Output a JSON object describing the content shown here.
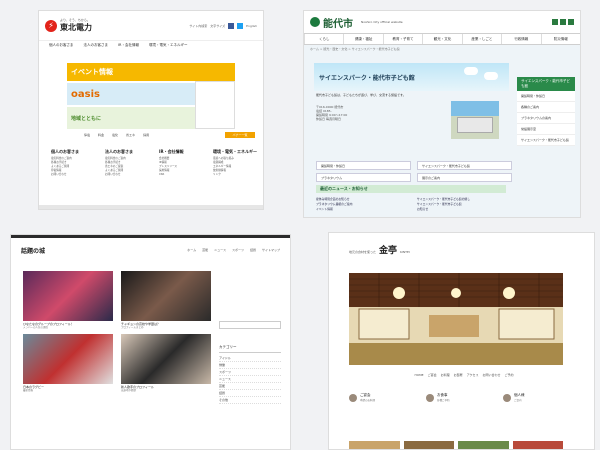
{
  "panel1": {
    "brand": "東北電力",
    "tagline": "より、そう、ちから。",
    "toplinks": [
      "サイト内検索",
      "文字サイズ",
      "English"
    ],
    "nav": [
      "個人のお客さま",
      "法人のお客さま",
      "IR・会社情報",
      "環境・電気・エネルギー"
    ],
    "banner1": "イベント情報",
    "banner2": "oasis",
    "banner3": "地域とともに",
    "links": [
      "停電",
      "料金",
      "電化",
      "省エネ",
      "採用"
    ],
    "button_label": "バナー一覧",
    "columns": [
      {
        "title": "個人のお客さま",
        "items": [
          "電気料金のご案内",
          "各種お手続き",
          "よくあるご質問",
          "停電情報",
          "お問い合わせ"
        ]
      },
      {
        "title": "法人のお客さま",
        "items": [
          "電気料金のご案内",
          "各種お手続き",
          "省エネのご提案",
          "よくあるご質問",
          "お問い合わせ"
        ]
      },
      {
        "title": "IR・会社情報",
        "items": [
          "会社概要",
          "IR情報",
          "プレスリリース",
          "採用情報",
          "CSR"
        ]
      },
      {
        "title": "環境・電気・エネルギー",
        "items": [
          "環境への取り組み",
          "電源構成",
          "エネルギー情報",
          "放射線情報",
          "リンク"
        ]
      }
    ]
  },
  "panel2": {
    "title": "能代市",
    "sub": "Noshiro City official website",
    "menu": [
      "くらし",
      "健康・福祉",
      "教育・子育て",
      "観光・文化",
      "産業・しごと",
      "行政情報",
      "防災情報"
    ],
    "crumb": "ホーム > 観光・歴史・文化 > サイエンスパーク・能代市子ども館",
    "hero_title": "サイエンスパーク・能代市子ども館",
    "content": [
      "能代市子ども館は、子どもたちが遊び、学び、交流する施設です。",
      "〒016-0000 能代市",
      "電話 0185-",
      "開館時間 9:00〜17:00",
      "休館日 毎週月曜日"
    ],
    "links": [
      "開館時間・休館日",
      "サイエンスパーク・能代市子ども館",
      "プラネタリウム",
      "展示のご案内"
    ],
    "news_title": "最近のニュース・お知らせ",
    "news": [
      "夏休み特別企画のお知らせ",
      "サイエンスパーク・能代市子ども館の催し",
      "プラネタリウム番組のご案内",
      "サイエンスパーク・能代市子ども館",
      "イベント情報",
      "お知らせ"
    ],
    "side_title": "サイエンスパーク・能代市子ども館",
    "side_items": [
      "開館時間・休館日",
      "各種のご案内",
      "プラネタリウムの案内",
      "常設展示室",
      "サイエンスパーク・能代市子ども館"
    ]
  },
  "panel3": {
    "logo": "話題の城",
    "nav": [
      "ホーム",
      "芸能",
      "ニュース",
      "スポーツ",
      "話題",
      "サイトマップ"
    ],
    "cards": [
      {
        "title": "ひなたなのグループのプロフィール！",
        "desc": "メンバーの人気の理由"
      },
      {
        "title": "チャギョンの高校や学歴は？",
        "desc": "プロフィールまとめ"
      },
      {
        "title": "日本のラグビー",
        "desc": "最新情報"
      },
      {
        "title": "新人歌手のプロフィール",
        "desc": "出身地や経歴"
      }
    ],
    "category_title": "カテゴリー",
    "categories": [
      "アイドル",
      "俳優",
      "スポーツ",
      "ニュース",
      "芸能",
      "話題",
      "その他"
    ]
  },
  "panel4": {
    "logo_small": "地元の食材を使った",
    "logo_main": "金亭",
    "logo_en": "KINTEI",
    "menu": [
      "HOME",
      "ご宴会",
      "お料理",
      "お部屋",
      "アクセス",
      "お問い合わせ",
      "ご予約"
    ],
    "staff": [
      {
        "name": "ご宴会",
        "desc": "季節のお料理"
      },
      {
        "name": "お食事",
        "desc": "各種ご予約"
      },
      {
        "name": "個人様",
        "desc": "ご案内"
      }
    ]
  }
}
